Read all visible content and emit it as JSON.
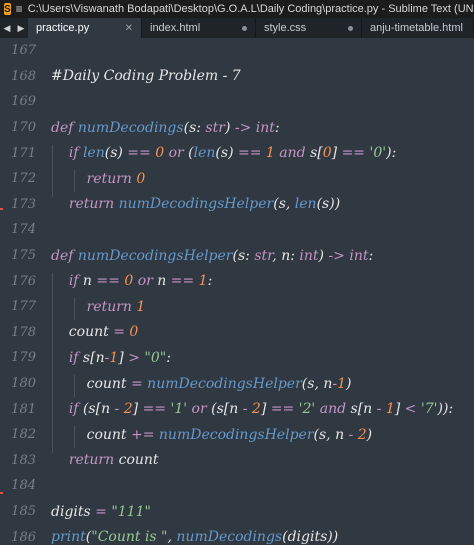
{
  "window": {
    "title": "C:\\Users\\Viswanath Bodapati\\Desktop\\G.O.A.L\\Daily Coding\\practice.py - Sublime Text (UNREGISTERED)"
  },
  "tabs": [
    {
      "label": "practice.py",
      "indicator": "close",
      "active": true
    },
    {
      "label": "index.html",
      "indicator": "dot",
      "active": false
    },
    {
      "label": "style.css",
      "indicator": "dot",
      "active": false
    },
    {
      "label": "anju-timetable.html",
      "indicator": "dot",
      "active": false
    }
  ],
  "editor": {
    "line_numbers": [
      "167",
      "168",
      "169",
      "170",
      "171",
      "172",
      "173",
      "174",
      "175",
      "176",
      "177",
      "178",
      "179",
      "180",
      "181",
      "182",
      "183",
      "184",
      "185",
      "186"
    ],
    "lines": [
      "",
      "#Daily Coding Problem - 7",
      "",
      "def numDecodings(s: str) -> int:",
      "    if len(s) == 0 or (len(s) == 1 and s[0] == '0'):",
      "        return 0",
      "    return numDecodingsHelper(s, len(s))",
      "",
      "def numDecodingsHelper(s: str, n: int) -> int:",
      "    if n == 0 or n == 1:",
      "        return 1",
      "    count = 0",
      "    if s[n-1] > \"0\":",
      "        count = numDecodingsHelper(s, n-1)",
      "    if (s[n - 2] == '1' or (s[n - 2] == '2' and s[n - 1] < '7')):",
      "        count += numDecodingsHelper(s, n - 2)",
      "    return count",
      "",
      "digits = \"111\"",
      "print(\"Count is \", numDecodings(digits))"
    ]
  },
  "colors": {
    "background": "#303841",
    "keyword": "#c594c5",
    "function": "#6699cc",
    "number": "#f99157",
    "string": "#99c794",
    "gutter": "#76808b"
  }
}
